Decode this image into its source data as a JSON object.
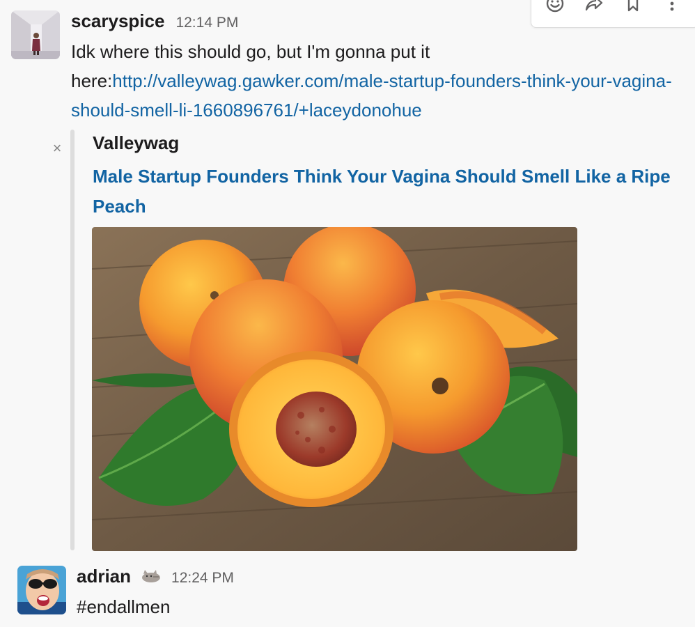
{
  "message_actions": {
    "items": [
      {
        "name": "add-reaction-icon"
      },
      {
        "name": "share-icon"
      },
      {
        "name": "bookmark-icon"
      },
      {
        "name": "more-actions-icon"
      }
    ]
  },
  "messages": [
    {
      "sender": "scaryspice",
      "time": "12:14 PM",
      "text_before": "Idk where this should go, but I'm gonna put it here:",
      "link": "http://valleywag.gawker.com/male-startup-founders-think-your-vagina-should-smell-li-1660896761/+laceydonohue",
      "attachment": {
        "close_glyph": "×",
        "service": "Valleywag",
        "title": "Male Startup Founders Think Your Vagina Should Smell Like a Ripe Peach",
        "image": "peaches-photo"
      }
    },
    {
      "sender": "adrian",
      "status_emoji": "pusheen-cat-emoji",
      "time": "12:24 PM",
      "text": "#endallmen"
    }
  ],
  "colors": {
    "link": "#1264a3",
    "background": "#f8f8f8",
    "timestamp": "#616061"
  }
}
